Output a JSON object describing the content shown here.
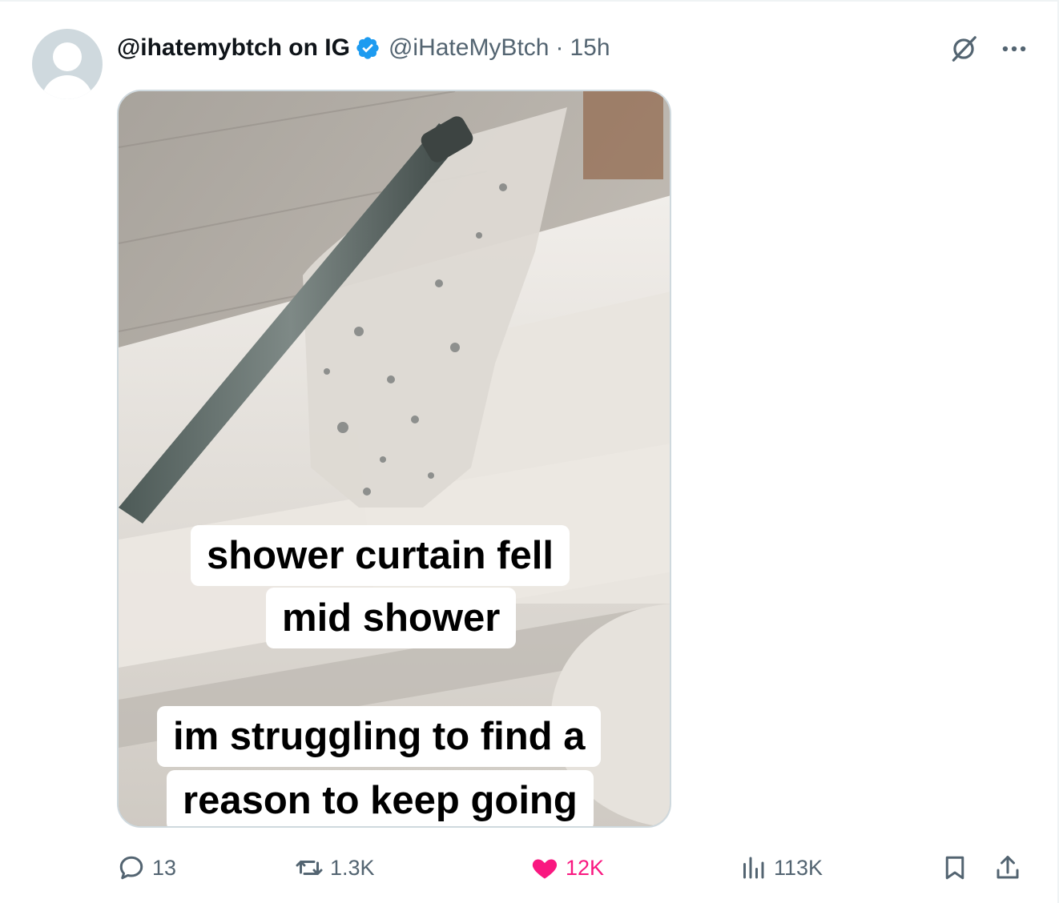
{
  "post": {
    "display_name": "@ihatemybtch on IG",
    "handle": "@iHateMyBtch",
    "separator": "·",
    "time": "15h",
    "media_captions": {
      "line1a": "shower curtain fell",
      "line1b": "mid shower",
      "line2a": "im struggling to find a",
      "line2b": "reason to keep going"
    },
    "stats": {
      "replies": "13",
      "reposts": "1.3K",
      "likes": "12K",
      "views": "113K"
    },
    "liked": true
  },
  "colors": {
    "text_primary": "#0f1419",
    "text_secondary": "#536471",
    "verified_blue": "#1d9bf0",
    "like_pink": "#f91880",
    "border": "#cfd9de"
  },
  "icons": [
    "avatar-placeholder",
    "verified-badge-icon",
    "grok-icon",
    "more-icon",
    "reply-icon",
    "retweet-icon",
    "heart-icon",
    "views-icon",
    "bookmark-icon",
    "share-icon"
  ]
}
